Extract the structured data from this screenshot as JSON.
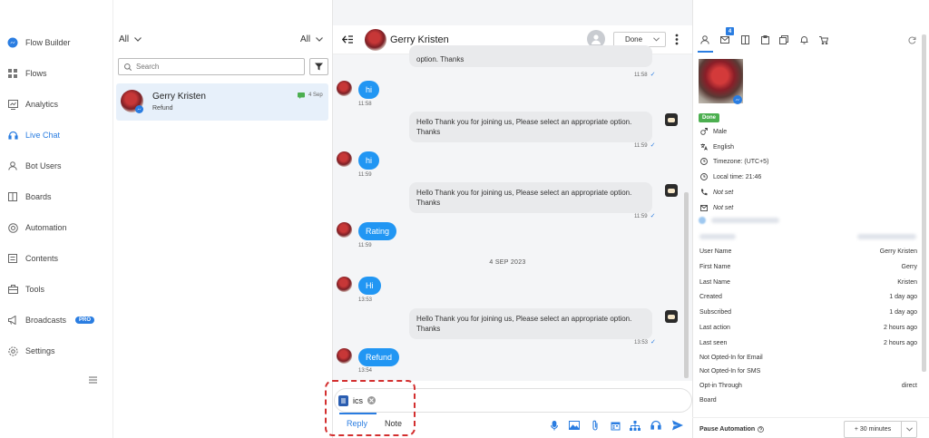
{
  "sidebar": {
    "items": [
      {
        "label": "Flow Builder",
        "icon": "messenger-icon"
      },
      {
        "label": "Flows",
        "icon": "grid-icon"
      },
      {
        "label": "Analytics",
        "icon": "chart-icon"
      },
      {
        "label": "Live Chat",
        "icon": "headset-icon",
        "active": true
      },
      {
        "label": "Bot Users",
        "icon": "user-icon"
      },
      {
        "label": "Boards",
        "icon": "board-icon"
      },
      {
        "label": "Automation",
        "icon": "automation-icon"
      },
      {
        "label": "Contents",
        "icon": "contents-icon"
      },
      {
        "label": "Tools",
        "icon": "tools-icon"
      },
      {
        "label": "Broadcasts",
        "icon": "broadcast-icon",
        "badge": "PRO"
      },
      {
        "label": "Settings",
        "icon": "settings-icon"
      }
    ]
  },
  "conversation_list": {
    "filter_left": "All",
    "filter_right": "All",
    "search_placeholder": "Search",
    "items": [
      {
        "name": "Gerry Kristen",
        "snippet": "Refund",
        "date": "4 Sep"
      }
    ]
  },
  "chat": {
    "contact_name": "Gerry Kristen",
    "status": "Done",
    "date_separator": "4 SEP 2023",
    "messages": [
      {
        "dir": "out",
        "text": "option. Thanks",
        "time": "11:58"
      },
      {
        "dir": "in",
        "text": "hi",
        "time": "11:58"
      },
      {
        "dir": "out",
        "text": "Hello Thank you for joining us, Please select an appropriate option. Thanks",
        "time": "11:59"
      },
      {
        "dir": "in",
        "text": "hi",
        "time": "11:59"
      },
      {
        "dir": "out",
        "text": "Hello Thank you for joining us, Please select an appropriate option. Thanks",
        "time": "11:59"
      },
      {
        "dir": "in",
        "text": "Rating",
        "time": "11:59"
      },
      {
        "dir": "in",
        "text": "Hi",
        "time": "13:53"
      },
      {
        "dir": "out",
        "text": "Hello Thank you for joining us, Please select an appropriate option. Thanks",
        "time": "13:53"
      },
      {
        "dir": "in",
        "text": "Refund",
        "time": "13:54"
      }
    ],
    "composer": {
      "chip_label": "ics",
      "tab_reply": "Reply",
      "tab_note": "Note"
    }
  },
  "profile": {
    "tab_badge": "4",
    "status_badge": "Done",
    "gender": "Male",
    "language": "English",
    "timezone": "Timezone: (UTC+5)",
    "local_time": "Local time: 21:46",
    "phone": "Not set",
    "email": "Not set",
    "attributes": [
      {
        "label": "User Name",
        "value": "Gerry Kristen"
      },
      {
        "label": "First Name",
        "value": "Gerry"
      },
      {
        "label": "Last Name",
        "value": "Kristen"
      },
      {
        "label": "Created",
        "value": "1 day ago"
      },
      {
        "label": "Subscribed",
        "value": "1 day ago"
      },
      {
        "label": "Last action",
        "value": "2 hours ago"
      },
      {
        "label": "Last seen",
        "value": "2 hours ago"
      },
      {
        "label": "Not Opted-In for Email",
        "value": ""
      },
      {
        "label": "Not Opted-In for SMS",
        "value": ""
      },
      {
        "label": "Opt-in Through",
        "value": "direct"
      },
      {
        "label": "Board",
        "value": ""
      }
    ],
    "pause_automation_label": "Pause Automation",
    "pause_automation_value": "+ 30 minutes"
  },
  "colors": {
    "accent": "#2a7de1",
    "bubble_in": "#2196f3",
    "done": "#4caf50",
    "highlight": "#d32f2f"
  }
}
